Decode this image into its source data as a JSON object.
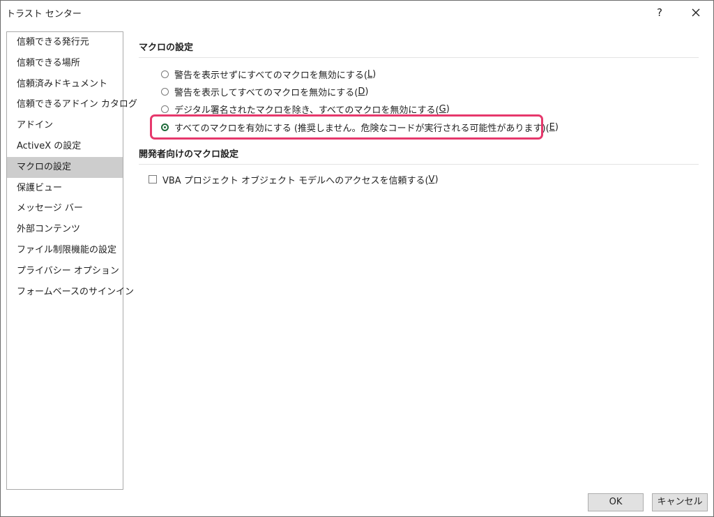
{
  "window": {
    "title": "トラスト センター",
    "help_label": "?"
  },
  "sidebar": {
    "items": [
      {
        "label": "信頼できる発行元"
      },
      {
        "label": "信頼できる場所"
      },
      {
        "label": "信頼済みドキュメント"
      },
      {
        "label": "信頼できるアドイン カタログ"
      },
      {
        "label": "アドイン"
      },
      {
        "label": "ActiveX の設定"
      },
      {
        "label": "マクロの設定",
        "selected": true
      },
      {
        "label": "保護ビュー"
      },
      {
        "label": "メッセージ バー"
      },
      {
        "label": "外部コンテンツ"
      },
      {
        "label": "ファイル制限機能の設定"
      },
      {
        "label": "プライバシー オプション"
      },
      {
        "label": "フォームベースのサインイン"
      }
    ]
  },
  "macro_settings": {
    "title": "マクロの設定",
    "options": [
      {
        "text": "警告を表示せずにすべてのマクロを無効にする(",
        "key": "L",
        "end": ")",
        "selected": false
      },
      {
        "text": "警告を表示してすべてのマクロを無効にする(",
        "key": "D",
        "end": ")",
        "selected": false
      },
      {
        "text": "デジタル署名されたマクロを除き、すべてのマクロを無効にする(",
        "key": "G",
        "end": ")",
        "selected": false
      },
      {
        "text": "すべてのマクロを有効にする (推奨しません。危険なコードが実行される可能性があります)(",
        "key": "E",
        "end": ")",
        "selected": true
      }
    ]
  },
  "developer_settings": {
    "title": "開発者向けのマクロ設定",
    "checkbox_text": "VBA プロジェクト オブジェクト モデルへのアクセスを信頼する(",
    "checkbox_key": "V",
    "checkbox_end": ")",
    "checked": false
  },
  "buttons": {
    "ok": "OK",
    "cancel": "キャンセル"
  },
  "colors": {
    "highlight": "#e6386c",
    "radio_selected": "#1e6b3a",
    "sidebar_selected": "#cdcdcd"
  }
}
